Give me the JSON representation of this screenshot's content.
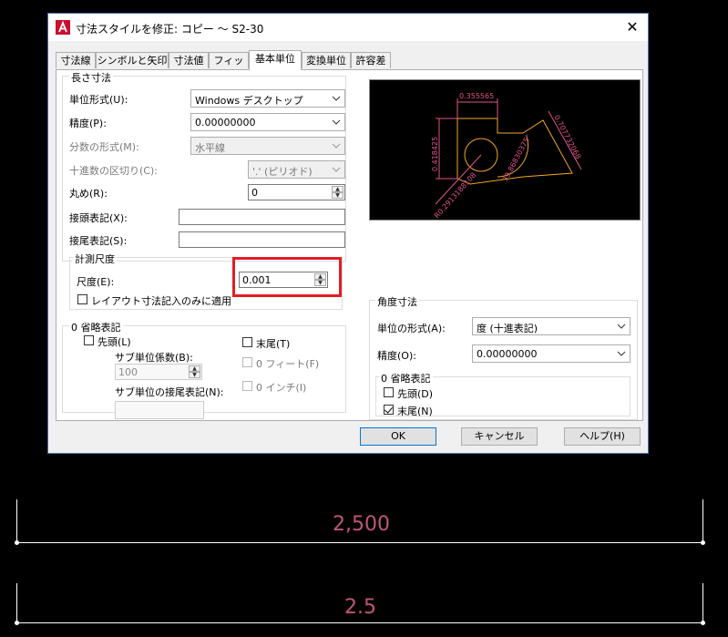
{
  "dialog": {
    "title": "寸法スタイルを修正: コピー 〜 S2-30",
    "close_symbol": "✕"
  },
  "tabs": [
    "寸法線",
    "シンボルと矢印",
    "寸法値",
    "フィット",
    "基本単位",
    "変換単位",
    "許容差"
  ],
  "linear": {
    "group_label": "長さ寸法",
    "unit_format_label": "単位形式(U):",
    "unit_format_value": "Windows デスクトップ",
    "precision_label": "精度(P):",
    "precision_value": "0.00000000",
    "fraction_label": "分数の形式(M):",
    "fraction_value": "水平線",
    "decimal_sep_label": "十進数の区切り(C):",
    "decimal_sep_value": "'.' (ピリオド)",
    "round_label": "丸め(R):",
    "round_value": "0",
    "prefix_label": "接頭表記(X):",
    "suffix_label": "接尾表記(S):"
  },
  "scale": {
    "group_label": "計測尺度",
    "scale_label": "尺度(E):",
    "scale_value": "0.001",
    "layout_only_label": "レイアウト寸法記入のみに適用"
  },
  "zero_linear": {
    "group_label": "0 省略表記",
    "leading_label": "先頭(L)",
    "trailing_label": "末尾(T)",
    "sub_factor_label": "サブ単位係数(B):",
    "sub_factor_value": "100",
    "sub_suffix_label": "サブ単位の接尾表記(N):",
    "feet_label": "0 フィート(F)",
    "inch_label": "0 インチ(I)"
  },
  "angular": {
    "group_label": "角度寸法",
    "unit_format_label": "単位の形式(A):",
    "unit_format_value": "度 (十進表記)",
    "precision_label": "精度(O):",
    "precision_value": "0.00000000",
    "zero_group_label": "0 省略表記",
    "leading_label": "先頭(D)",
    "trailing_label": "末尾(N)"
  },
  "preview": {
    "dim_top": "0.355565",
    "dim_left": "0.418425",
    "dim_right": "0.707732068",
    "dim_angle": "39.86830375°",
    "dim_radius": "R0.2913188108"
  },
  "buttons": {
    "ok": "OK",
    "cancel": "キャンセル",
    "help": "ヘルプ(H)"
  },
  "drawing": {
    "dim1": "2,500",
    "dim2": "2.5"
  },
  "colors": {
    "highlight": "#e31c23",
    "dim_text": "#c0557a",
    "preview_line": "#f5a623",
    "preview_dim": "#e0558a"
  }
}
